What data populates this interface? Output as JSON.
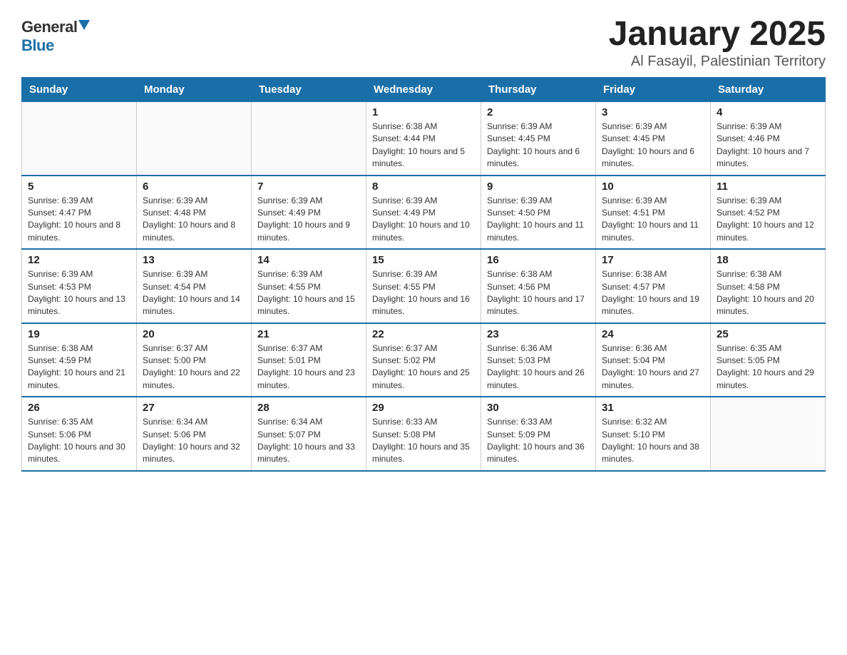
{
  "logo": {
    "general": "General",
    "blue": "Blue"
  },
  "title": "January 2025",
  "location": "Al Fasayil, Palestinian Territory",
  "headers": [
    "Sunday",
    "Monday",
    "Tuesday",
    "Wednesday",
    "Thursday",
    "Friday",
    "Saturday"
  ],
  "weeks": [
    [
      {
        "day": "",
        "info": ""
      },
      {
        "day": "",
        "info": ""
      },
      {
        "day": "",
        "info": ""
      },
      {
        "day": "1",
        "info": "Sunrise: 6:38 AM\nSunset: 4:44 PM\nDaylight: 10 hours and 5 minutes."
      },
      {
        "day": "2",
        "info": "Sunrise: 6:39 AM\nSunset: 4:45 PM\nDaylight: 10 hours and 6 minutes."
      },
      {
        "day": "3",
        "info": "Sunrise: 6:39 AM\nSunset: 4:45 PM\nDaylight: 10 hours and 6 minutes."
      },
      {
        "day": "4",
        "info": "Sunrise: 6:39 AM\nSunset: 4:46 PM\nDaylight: 10 hours and 7 minutes."
      }
    ],
    [
      {
        "day": "5",
        "info": "Sunrise: 6:39 AM\nSunset: 4:47 PM\nDaylight: 10 hours and 8 minutes."
      },
      {
        "day": "6",
        "info": "Sunrise: 6:39 AM\nSunset: 4:48 PM\nDaylight: 10 hours and 8 minutes."
      },
      {
        "day": "7",
        "info": "Sunrise: 6:39 AM\nSunset: 4:49 PM\nDaylight: 10 hours and 9 minutes."
      },
      {
        "day": "8",
        "info": "Sunrise: 6:39 AM\nSunset: 4:49 PM\nDaylight: 10 hours and 10 minutes."
      },
      {
        "day": "9",
        "info": "Sunrise: 6:39 AM\nSunset: 4:50 PM\nDaylight: 10 hours and 11 minutes."
      },
      {
        "day": "10",
        "info": "Sunrise: 6:39 AM\nSunset: 4:51 PM\nDaylight: 10 hours and 11 minutes."
      },
      {
        "day": "11",
        "info": "Sunrise: 6:39 AM\nSunset: 4:52 PM\nDaylight: 10 hours and 12 minutes."
      }
    ],
    [
      {
        "day": "12",
        "info": "Sunrise: 6:39 AM\nSunset: 4:53 PM\nDaylight: 10 hours and 13 minutes."
      },
      {
        "day": "13",
        "info": "Sunrise: 6:39 AM\nSunset: 4:54 PM\nDaylight: 10 hours and 14 minutes."
      },
      {
        "day": "14",
        "info": "Sunrise: 6:39 AM\nSunset: 4:55 PM\nDaylight: 10 hours and 15 minutes."
      },
      {
        "day": "15",
        "info": "Sunrise: 6:39 AM\nSunset: 4:55 PM\nDaylight: 10 hours and 16 minutes."
      },
      {
        "day": "16",
        "info": "Sunrise: 6:38 AM\nSunset: 4:56 PM\nDaylight: 10 hours and 17 minutes."
      },
      {
        "day": "17",
        "info": "Sunrise: 6:38 AM\nSunset: 4:57 PM\nDaylight: 10 hours and 19 minutes."
      },
      {
        "day": "18",
        "info": "Sunrise: 6:38 AM\nSunset: 4:58 PM\nDaylight: 10 hours and 20 minutes."
      }
    ],
    [
      {
        "day": "19",
        "info": "Sunrise: 6:38 AM\nSunset: 4:59 PM\nDaylight: 10 hours and 21 minutes."
      },
      {
        "day": "20",
        "info": "Sunrise: 6:37 AM\nSunset: 5:00 PM\nDaylight: 10 hours and 22 minutes."
      },
      {
        "day": "21",
        "info": "Sunrise: 6:37 AM\nSunset: 5:01 PM\nDaylight: 10 hours and 23 minutes."
      },
      {
        "day": "22",
        "info": "Sunrise: 6:37 AM\nSunset: 5:02 PM\nDaylight: 10 hours and 25 minutes."
      },
      {
        "day": "23",
        "info": "Sunrise: 6:36 AM\nSunset: 5:03 PM\nDaylight: 10 hours and 26 minutes."
      },
      {
        "day": "24",
        "info": "Sunrise: 6:36 AM\nSunset: 5:04 PM\nDaylight: 10 hours and 27 minutes."
      },
      {
        "day": "25",
        "info": "Sunrise: 6:35 AM\nSunset: 5:05 PM\nDaylight: 10 hours and 29 minutes."
      }
    ],
    [
      {
        "day": "26",
        "info": "Sunrise: 6:35 AM\nSunset: 5:06 PM\nDaylight: 10 hours and 30 minutes."
      },
      {
        "day": "27",
        "info": "Sunrise: 6:34 AM\nSunset: 5:06 PM\nDaylight: 10 hours and 32 minutes."
      },
      {
        "day": "28",
        "info": "Sunrise: 6:34 AM\nSunset: 5:07 PM\nDaylight: 10 hours and 33 minutes."
      },
      {
        "day": "29",
        "info": "Sunrise: 6:33 AM\nSunset: 5:08 PM\nDaylight: 10 hours and 35 minutes."
      },
      {
        "day": "30",
        "info": "Sunrise: 6:33 AM\nSunset: 5:09 PM\nDaylight: 10 hours and 36 minutes."
      },
      {
        "day": "31",
        "info": "Sunrise: 6:32 AM\nSunset: 5:10 PM\nDaylight: 10 hours and 38 minutes."
      },
      {
        "day": "",
        "info": ""
      }
    ]
  ]
}
